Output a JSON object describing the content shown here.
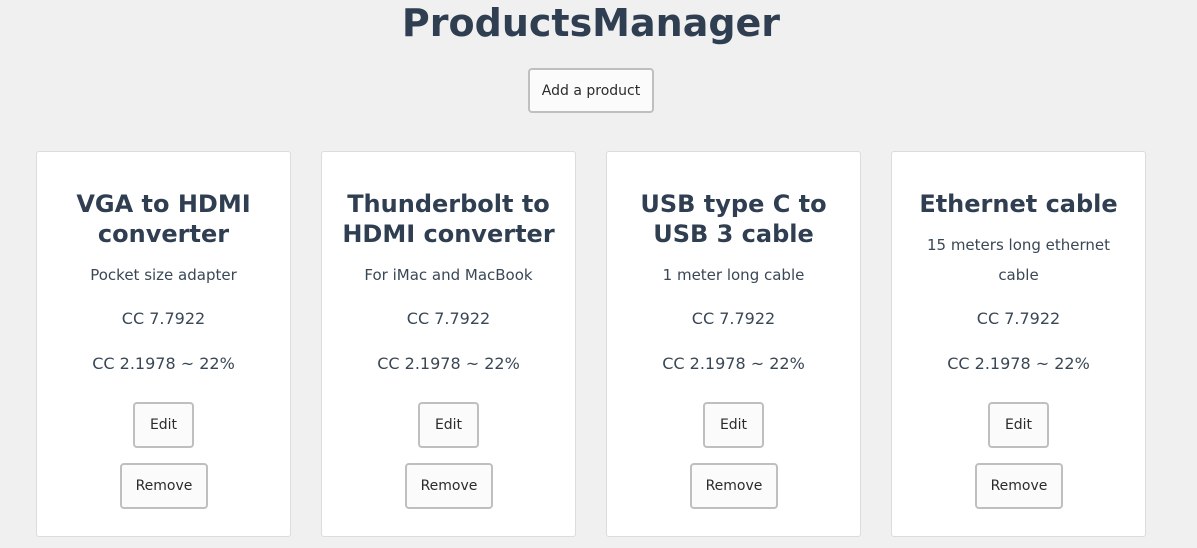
{
  "header": {
    "title": "ProductsManager",
    "add_button_label": "Add a product"
  },
  "products": [
    {
      "name": "VGA to HDMI converter",
      "description": "Pocket size adapter",
      "price": "CC 7.7922",
      "tax": "CC 2.1978 ~ 22%",
      "edit_label": "Edit",
      "remove_label": "Remove"
    },
    {
      "name": "Thunderbolt to HDMI converter",
      "description": "For iMac and MacBook",
      "price": "CC 7.7922",
      "tax": "CC 2.1978 ~ 22%",
      "edit_label": "Edit",
      "remove_label": "Remove"
    },
    {
      "name": "USB type C to USB 3 cable",
      "description": "1 meter long cable",
      "price": "CC 7.7922",
      "tax": "CC 2.1978 ~ 22%",
      "edit_label": "Edit",
      "remove_label": "Remove"
    },
    {
      "name": "Ethernet cable",
      "description": "15 meters long ethernet cable",
      "price": "CC 7.7922",
      "tax": "CC 2.1978 ~ 22%",
      "edit_label": "Edit",
      "remove_label": "Remove"
    }
  ]
}
